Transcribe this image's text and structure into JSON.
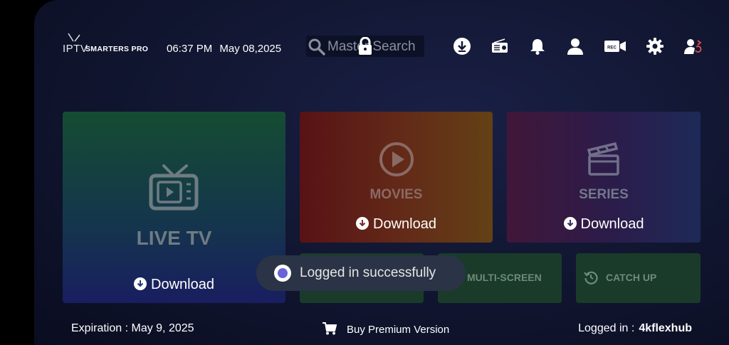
{
  "header": {
    "logo": {
      "iptv": "IPTV",
      "brand": "SMARTERS PRO"
    },
    "time": "06:37 PM",
    "date": "May 08,2025",
    "search_text": "Master Search",
    "icons": [
      "download-icon",
      "radio-icon",
      "bell-icon",
      "user-icon",
      "rec-camera-icon",
      "gear-icon",
      "switch-user-icon"
    ],
    "rec_label": "REC"
  },
  "tiles": {
    "live": {
      "title": "LIVE TV",
      "action": "Download"
    },
    "movies": {
      "title": "MOVIES",
      "action": "Download"
    },
    "series": {
      "title": "SERIES",
      "action": "Download"
    },
    "multiscreen": {
      "title": "MULTI-SCREEN"
    },
    "catchup": {
      "title": "CATCH UP"
    }
  },
  "toast": {
    "message": "Logged in successfully"
  },
  "footer": {
    "expiration": "Expiration : May 9, 2025",
    "buy": "Buy Premium Version",
    "logged_label": "Logged in :",
    "username": "4kflexhub"
  }
}
